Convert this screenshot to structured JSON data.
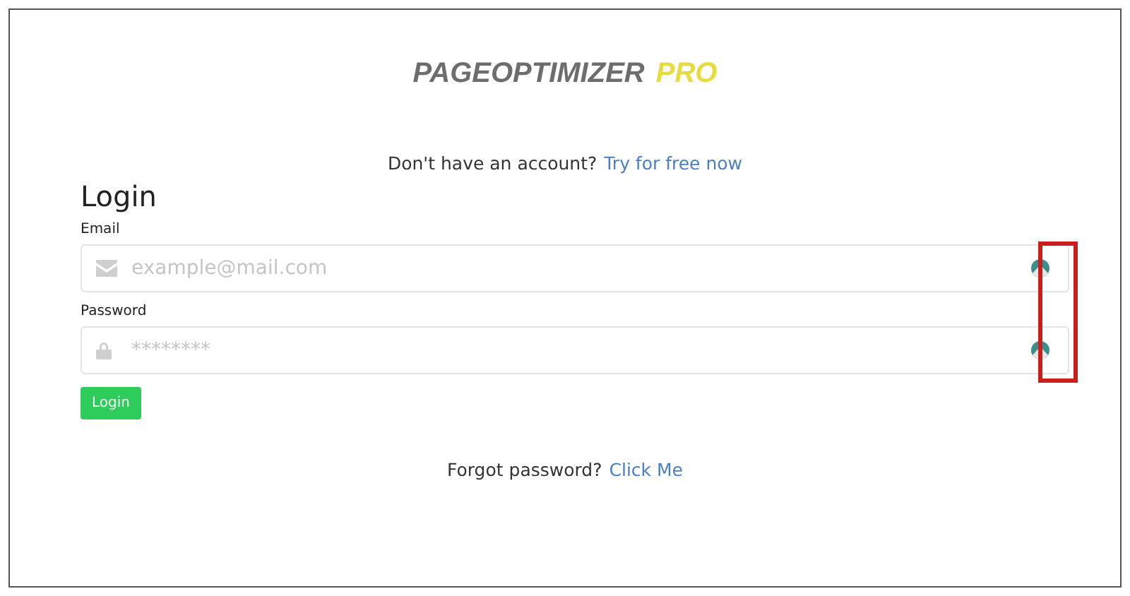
{
  "logo": {
    "name": "PAGEOPTIMIZER",
    "suffix": "PRO"
  },
  "signup": {
    "text": "Don't have an account?",
    "link": "Try for free now"
  },
  "form": {
    "title": "Login",
    "fields": [
      {
        "label": "Email",
        "placeholder": "example@mail.com",
        "kind": "email"
      },
      {
        "label": "Password",
        "placeholder": "********",
        "kind": "password"
      }
    ],
    "button": "Login"
  },
  "forgot": {
    "text": "Forgot password?",
    "link": "Click Me"
  }
}
